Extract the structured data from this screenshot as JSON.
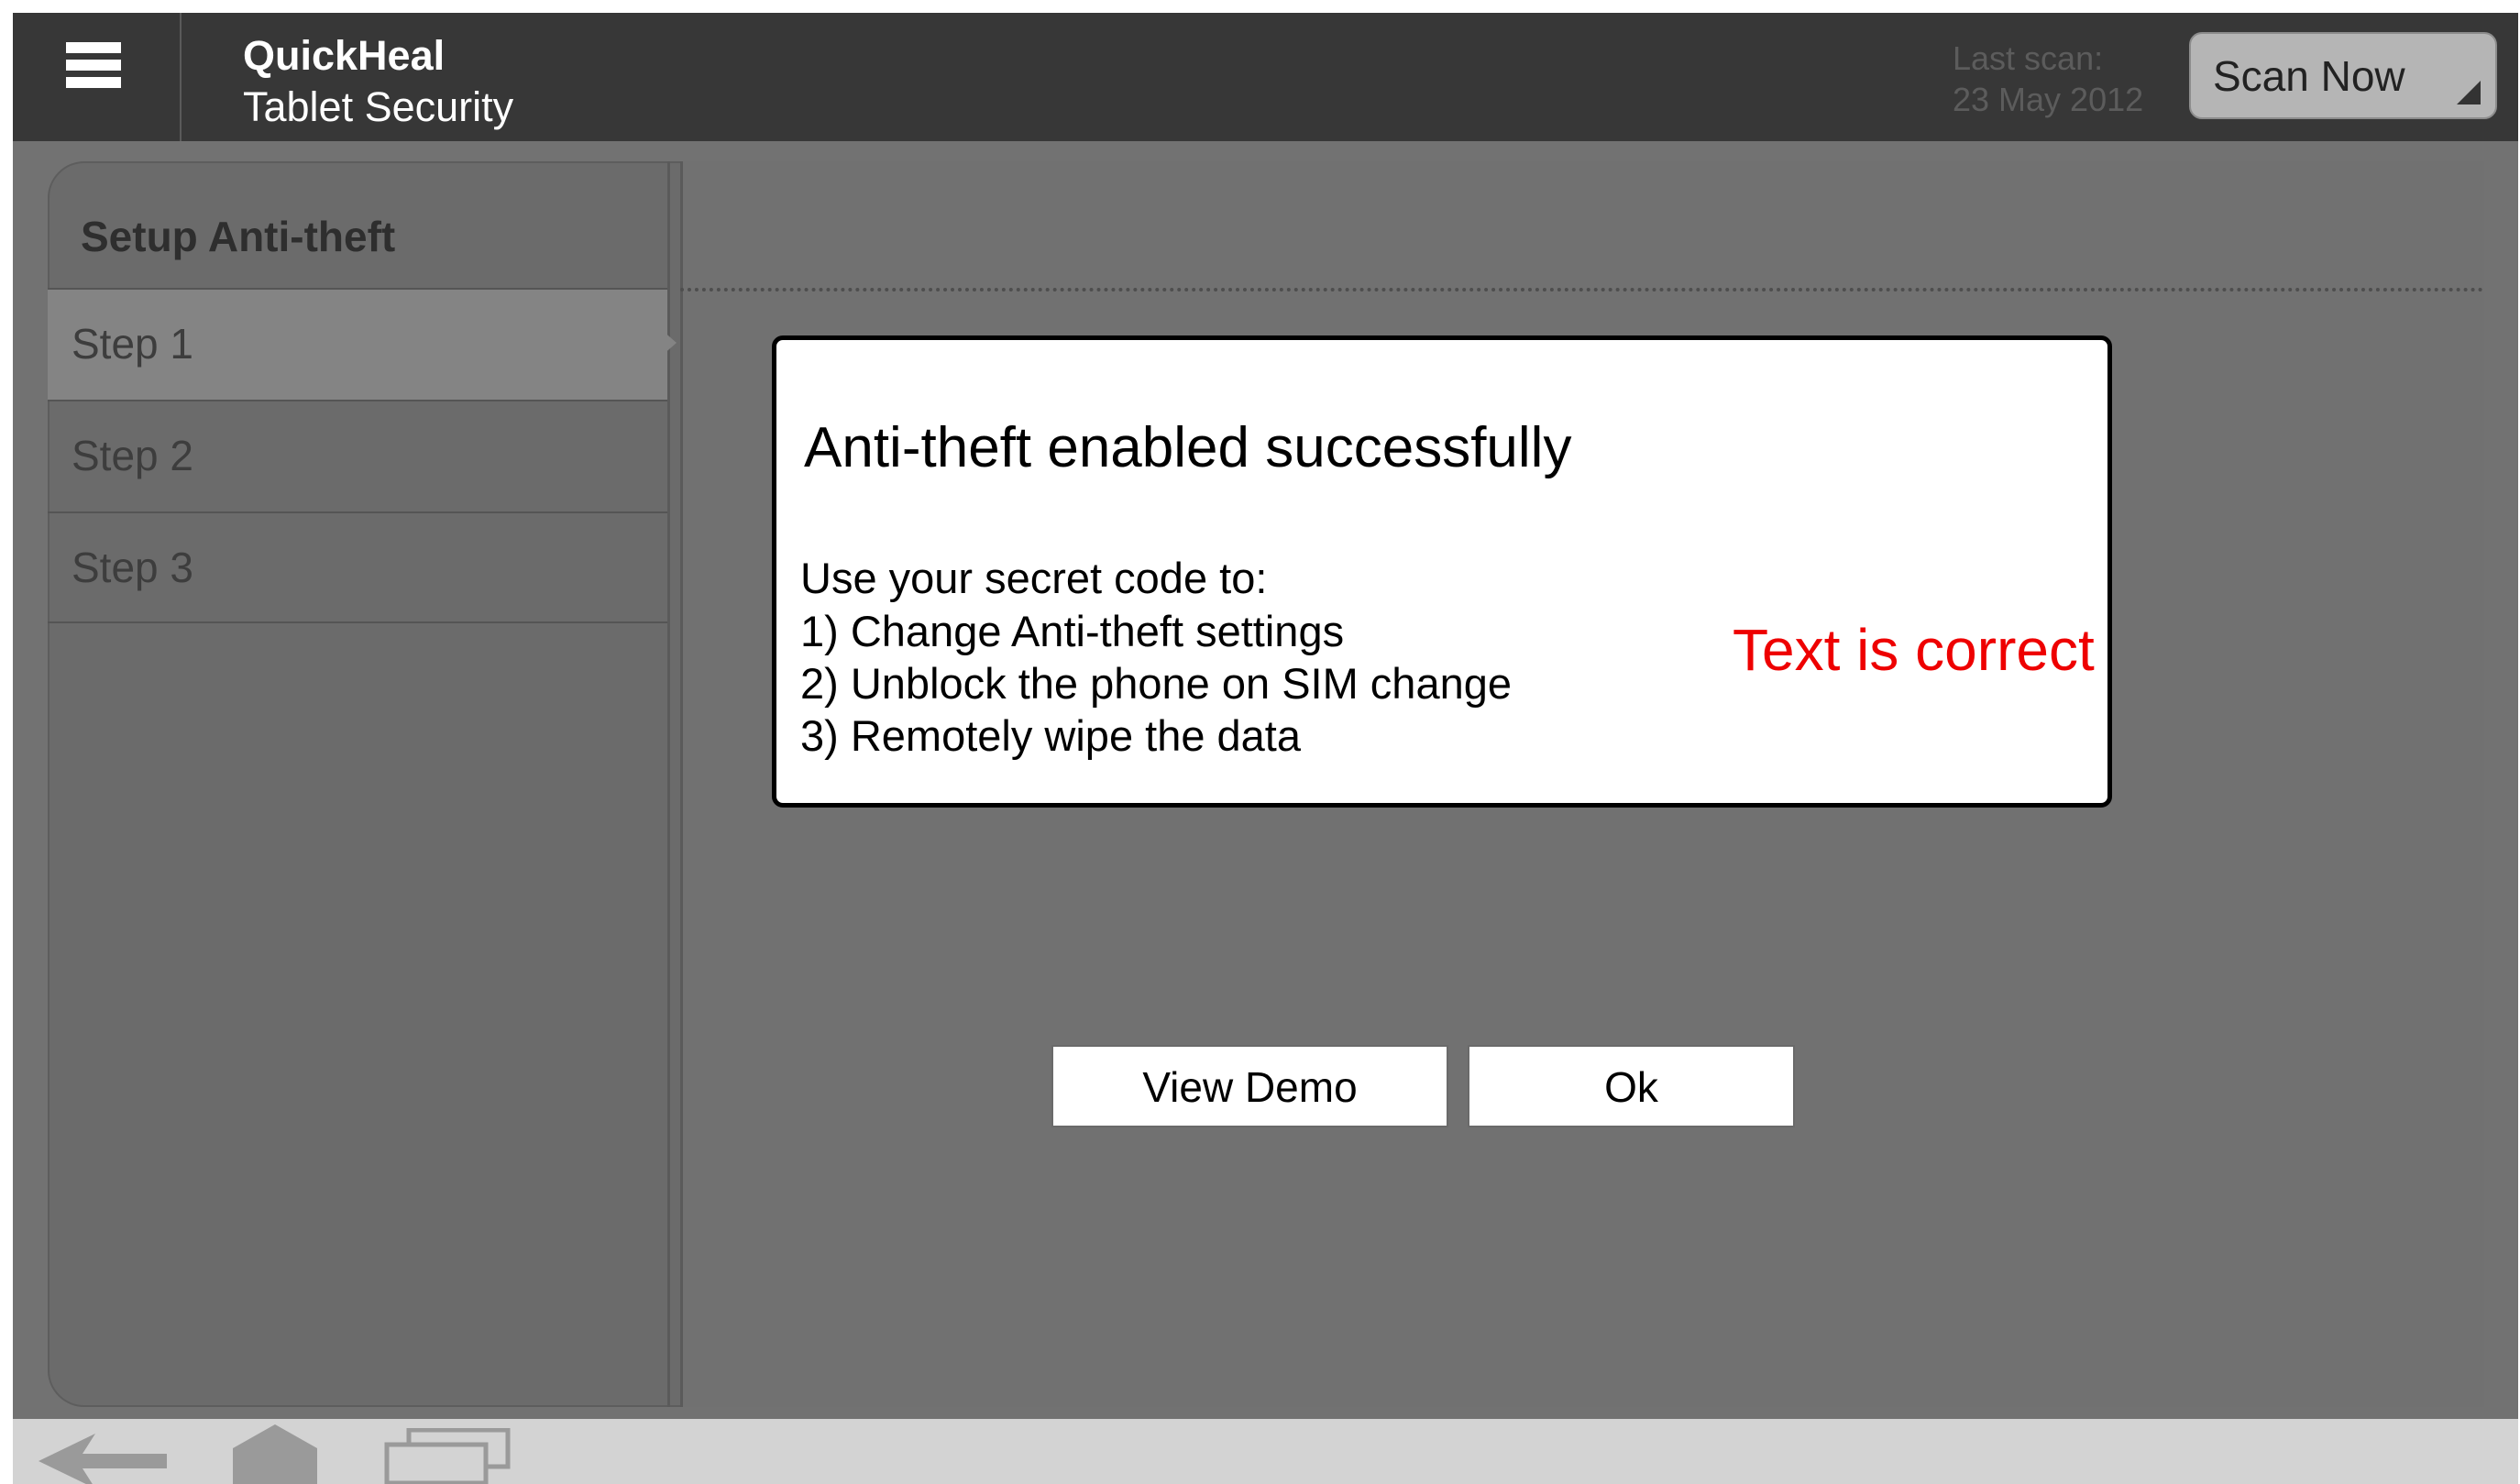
{
  "header": {
    "app_name": "QuickHeal",
    "app_subtitle": "Tablet Security",
    "last_scan_label": "Last scan:",
    "last_scan_date": "23 May 2012",
    "scan_button_label": "Scan Now"
  },
  "sidebar": {
    "title": "Setup Anti-theft",
    "steps": [
      {
        "label": "Step 1",
        "active": true
      },
      {
        "label": "Step 2",
        "active": false
      },
      {
        "label": "Step 3",
        "active": false
      }
    ]
  },
  "dialog": {
    "title": "Anti-theft enabled successfully",
    "intro": "Use your secret code to:",
    "items": [
      "1) Change Anti-theft settings",
      "2) Unblock the phone on SIM change",
      "3) Remotely wipe the data"
    ],
    "annotation": "Text is correct",
    "view_demo_label": "View Demo",
    "ok_label": "Ok"
  },
  "colors": {
    "header_bg": "#373737",
    "content_bg": "#727272",
    "annotation": "#ee0000",
    "bottom_bar": "#d3d3d3"
  },
  "nav_icons": [
    "back-arrow-icon",
    "home-icon",
    "recent-apps-icon"
  ]
}
